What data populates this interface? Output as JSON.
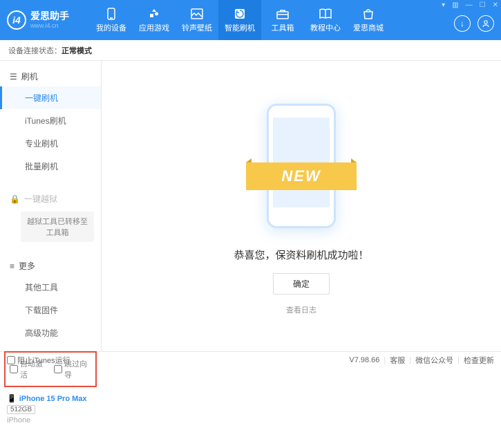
{
  "header": {
    "logo_text": "爱思助手",
    "logo_sub": "www.i4.cn",
    "nav": [
      {
        "label": "我的设备"
      },
      {
        "label": "应用游戏"
      },
      {
        "label": "铃声壁纸"
      },
      {
        "label": "智能刷机"
      },
      {
        "label": "工具箱"
      },
      {
        "label": "教程中心"
      },
      {
        "label": "爱思商城"
      }
    ]
  },
  "status": {
    "label": "设备连接状态：",
    "value": "正常模式"
  },
  "sidebar": {
    "flash_head": "刷机",
    "items": {
      "onekey": "一键刷机",
      "itunes": "iTunes刷机",
      "pro": "专业刷机",
      "batch": "批量刷机"
    },
    "jailbreak_head": "一键越狱",
    "jailbreak_note": "越狱工具已转移至工具箱",
    "more_head": "更多",
    "more": {
      "other": "其他工具",
      "download": "下载固件",
      "advanced": "高级功能"
    },
    "checkboxes": {
      "auto_activate": "自动激活",
      "skip_guide": "跳过向导"
    },
    "device": {
      "name": "iPhone 15 Pro Max",
      "storage": "512GB",
      "type": "iPhone"
    }
  },
  "main": {
    "banner": "NEW",
    "success": "恭喜您，保资料刷机成功啦！",
    "ok": "确定",
    "log": "查看日志"
  },
  "footer": {
    "block_itunes": "阻止iTunes运行",
    "version": "V7.98.66",
    "service": "客服",
    "wechat": "微信公众号",
    "update": "检查更新"
  }
}
